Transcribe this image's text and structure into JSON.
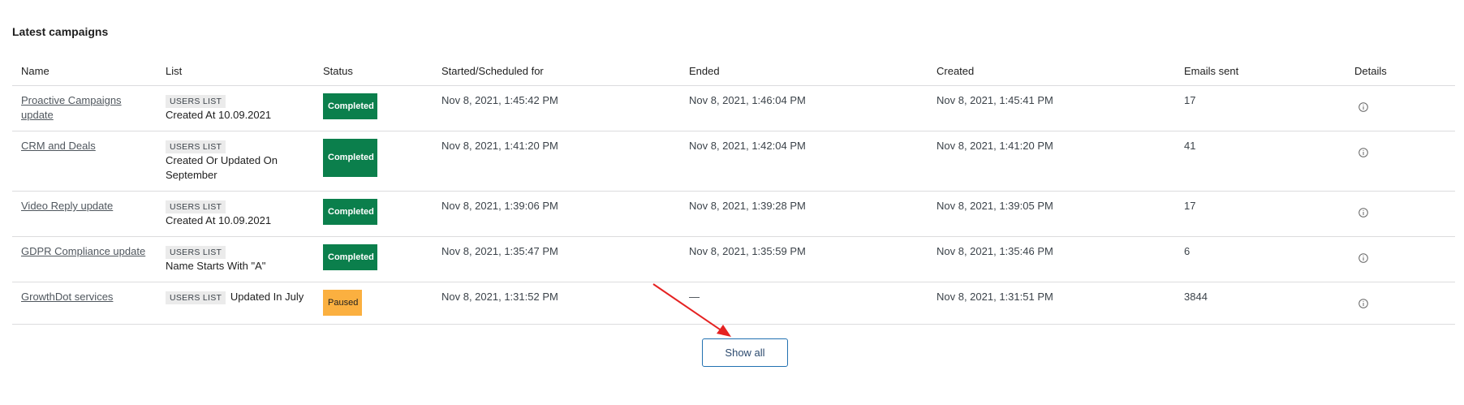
{
  "section": {
    "title": "Latest campaigns"
  },
  "table": {
    "headers": {
      "name": "Name",
      "list": "List",
      "status": "Status",
      "started": "Started/Scheduled for",
      "ended": "Ended",
      "created": "Created",
      "emails_sent": "Emails sent",
      "details": "Details"
    },
    "rows": [
      {
        "name": "Proactive Campaigns update",
        "list_tag": "USERS LIST",
        "list_desc": "Created At 10.09.2021",
        "status": "Completed",
        "started": "Nov 8, 2021, 1:45:42 PM",
        "ended": "Nov 8, 2021, 1:46:04 PM",
        "created": "Nov 8, 2021, 1:45:41 PM",
        "emails_sent": "17"
      },
      {
        "name": "CRM and Deals",
        "list_tag": "USERS LIST",
        "list_desc": "Created Or Updated On September",
        "status": "Completed",
        "started": "Nov 8, 2021, 1:41:20 PM",
        "ended": "Nov 8, 2021, 1:42:04 PM",
        "created": "Nov 8, 2021, 1:41:20 PM",
        "emails_sent": "41"
      },
      {
        "name": "Video Reply update",
        "list_tag": "USERS LIST",
        "list_desc": "Created At 10.09.2021",
        "status": "Completed",
        "started": "Nov 8, 2021, 1:39:06 PM",
        "ended": "Nov 8, 2021, 1:39:28 PM",
        "created": "Nov 8, 2021, 1:39:05 PM",
        "emails_sent": "17"
      },
      {
        "name": "GDPR Compliance update",
        "list_tag": "USERS LIST",
        "list_desc": "Name Starts With \"A\"",
        "status": "Completed",
        "started": "Nov 8, 2021, 1:35:47 PM",
        "ended": "Nov 8, 2021, 1:35:59 PM",
        "created": "Nov 8, 2021, 1:35:46 PM",
        "emails_sent": "6"
      },
      {
        "name": "GrowthDot services",
        "list_tag": "USERS LIST",
        "list_desc": "Updated In July",
        "status": "Paused",
        "started": "Nov 8, 2021, 1:31:52 PM",
        "ended": "—",
        "created": "Nov 8, 2021, 1:31:51 PM",
        "emails_sent": "3844"
      }
    ]
  },
  "actions": {
    "show_all": "Show all"
  },
  "icons": {
    "details": "info-circle-icon",
    "annotation": "red-arrow-icon"
  },
  "colors": {
    "completed": "#0b7f4c",
    "paused": "#fbb040",
    "annotation": "#e52222",
    "button_border": "#2271b1"
  }
}
